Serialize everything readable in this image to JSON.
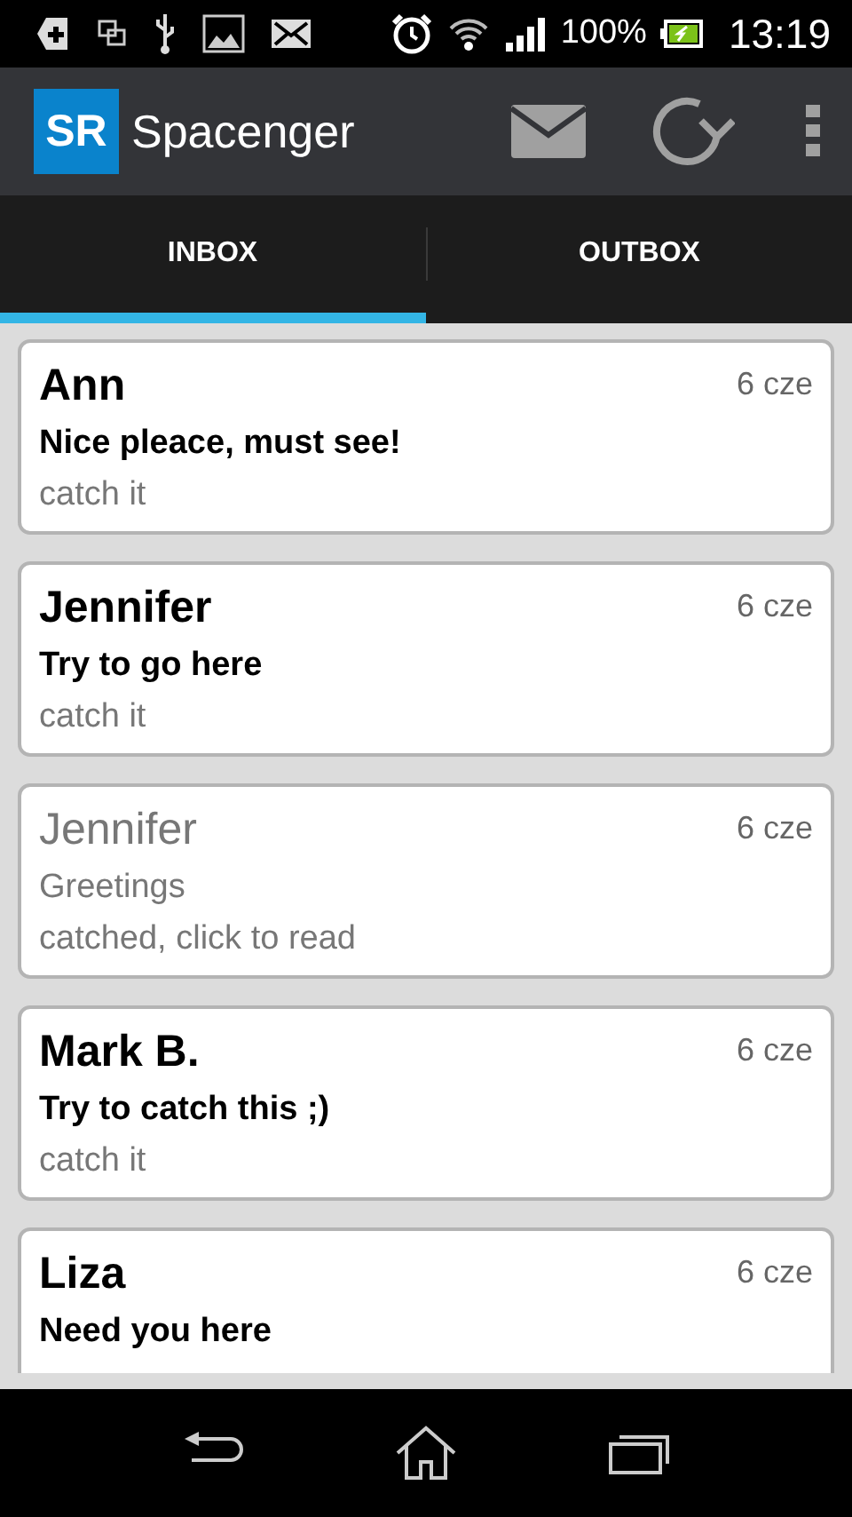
{
  "status_bar": {
    "battery": "100%",
    "time": "13:19"
  },
  "app_bar": {
    "logo": "SR",
    "title": "Spacenger"
  },
  "tabs": [
    {
      "label": "INBOX",
      "selected": true
    },
    {
      "label": "OUTBOX",
      "selected": false
    }
  ],
  "messages": [
    {
      "sender": "Ann",
      "date": "6 cze",
      "subject": "Nice pleace, must see!",
      "status": "catch it",
      "read": false
    },
    {
      "sender": "Jennifer",
      "date": "6 cze",
      "subject": "Try to go here",
      "status": "catch it",
      "read": false
    },
    {
      "sender": "Jennifer",
      "date": "6 cze",
      "subject": "Greetings",
      "status": "catched, click to read",
      "read": true
    },
    {
      "sender": "Mark B.",
      "date": "6 cze",
      "subject": "Try to catch this ;)",
      "status": "catch it",
      "read": false
    },
    {
      "sender": "Liza",
      "date": "6 cze",
      "subject": "Need you here",
      "read": false
    }
  ]
}
